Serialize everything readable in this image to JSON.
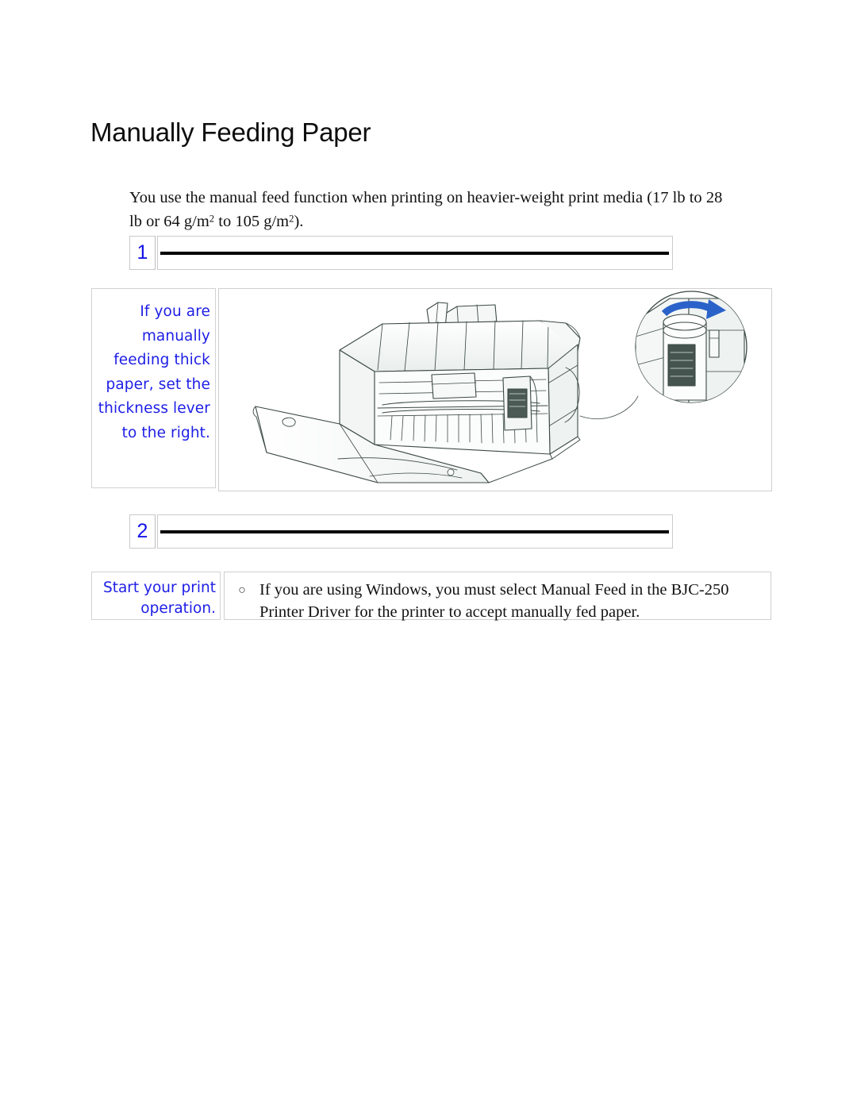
{
  "document": {
    "title": "Manually Feeding Paper",
    "intro_paragraph": "You use the manual feed function when printing on heavier-weight print media (17 lb to 28 lb or 64 g/m² to 105 g/m²).",
    "intro_line_1": "You use the manual feed function when printing on heavier-weight print media (17 lb to",
    "intro_line_2_pre": "28 lb or 64 g/m",
    "intro_sup_1": "2",
    "intro_line_2_mid": " to 105 g/m",
    "intro_sup_2": "2",
    "intro_line_2_end": ")."
  },
  "steps": [
    {
      "number": "1",
      "text": ""
    },
    {
      "number": "2",
      "text": ""
    }
  ],
  "illustration_row": {
    "caption": "If you are manually feeding thick paper, set the thickness lever to the right.",
    "figure_alt": "BJC-250 printer with front cover open and a magnified circular callout of the paper thickness lever with a blue arrow indicating movement to the right"
  },
  "final_row": {
    "caption": "Start your print operation.",
    "bullet_glyph": "○",
    "bullet_text": "If you are using Windows, you must select Manual Feed in the BJC-250 Printer Driver for the printer to accept manually fed paper.",
    "bullet_line_1": "If you are using Windows, you must select Manual Feed in the BJC-250",
    "bullet_line_2": "Printer Driver for the printer to accept manually fed paper."
  },
  "colors": {
    "caption_blue": "#1e1ee6",
    "step_number_blue": "#1515e8",
    "rule_black": "#000000",
    "border_gray": "#cfcfcf",
    "arrow_blue": "#2b62c9",
    "text_black": "#111111",
    "page_background": "#ffffff"
  }
}
